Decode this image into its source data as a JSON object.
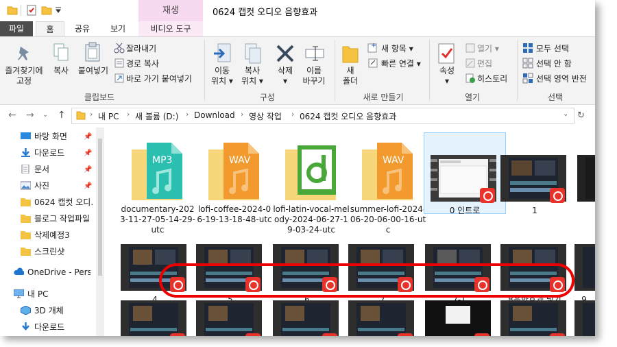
{
  "title": {
    "playing_tab": "재생",
    "folder_name": "0624 캡컷 오디오 음향효과"
  },
  "tabs": {
    "file": "파일",
    "home": "홈",
    "share": "공유",
    "view": "보기",
    "video_tools": "비디오 도구"
  },
  "ribbon": {
    "clipboard": {
      "pin": "즐겨찾기에\n고정",
      "copy": "복사",
      "paste": "붙여넣기",
      "cut": "잘라내기",
      "copy_path": "경로 복사",
      "paste_shortcut": "바로 가기 붙여넣기",
      "group": "클립보드"
    },
    "organize": {
      "move_to": "이동\n위치 ▾",
      "copy_to": "복사\n위치 ▾",
      "delete": "삭제\n▾",
      "rename": "이름\n바꾸기",
      "group": "구성"
    },
    "new": {
      "new_folder": "새\n폴더",
      "new_item": "새 항목 ▾",
      "easy_access": "빠른 연결 ▾",
      "group": "새로 만들기"
    },
    "open": {
      "properties": "속성\n▾",
      "open": "열기 ▾",
      "edit": "편집",
      "history": "히스토리",
      "group": "열기"
    },
    "select": {
      "select_all": "모두 선택",
      "select_none": "선택 안 함",
      "invert": "선택 영역 반전",
      "group": "선택"
    }
  },
  "address": {
    "crumbs": [
      "내 PC",
      "새 볼륨 (D:)",
      "Download",
      "영상 작업",
      "0624 캡컷 오디오 음향효과"
    ]
  },
  "nav": {
    "items": [
      {
        "label": "바탕 화면",
        "pinned": true
      },
      {
        "label": "다운로드",
        "pinned": true
      },
      {
        "label": "문서",
        "pinned": true
      },
      {
        "label": "사진",
        "pinned": true
      },
      {
        "label": "0624 캡컷 오디.",
        "pinned": false
      },
      {
        "label": "블로그 작업파일",
        "pinned": false
      },
      {
        "label": "삭제예정3",
        "pinned": false
      },
      {
        "label": "스크린샷",
        "pinned": false
      }
    ],
    "onedrive": "OneDrive - Person",
    "thispc": "내 PC",
    "objects3d": "3D 개체",
    "downloads2": "다운로드"
  },
  "files": {
    "row1": [
      {
        "name": "documentary-2023-11-27-05-14-29-utc",
        "type": "mp3",
        "tag": "MP3"
      },
      {
        "name": "lofi-coffee-2024-06-19-13-18-48-utc",
        "type": "wav",
        "tag": "WAV"
      },
      {
        "name": "lofi-latin-vocal-melody-2024-06-27-19-03-24-utc",
        "type": "audition"
      },
      {
        "name": "summer-lofi-2024-06-20-06-00-16-utc",
        "type": "wav",
        "tag": "WAV"
      },
      {
        "name": "0 인트로",
        "type": "video"
      },
      {
        "name": "1",
        "type": "video"
      }
    ],
    "row2": [
      {
        "name": "4"
      },
      {
        "name": "5"
      },
      {
        "name": "6"
      },
      {
        "name": "7"
      },
      {
        "name": "7-1"
      },
      {
        "name": "8음향효과 넣기"
      },
      {
        "name": "9"
      }
    ]
  },
  "colors": {
    "accent": "#0078d7",
    "badge": "#e8322a",
    "highlight_ring": "#ee0000",
    "playing_tab": "#f7d9f0"
  }
}
